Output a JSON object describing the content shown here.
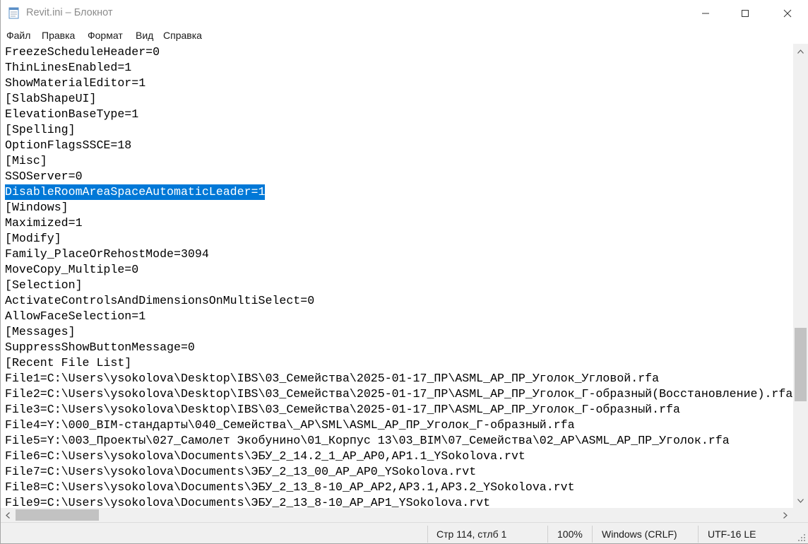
{
  "window": {
    "title": "Revit.ini – Блокнот"
  },
  "menu": {
    "items": [
      "Файл",
      "Правка",
      "Формат",
      "Вид",
      "Справка"
    ]
  },
  "editor": {
    "lines": [
      "FreezeScheduleHeader=0",
      "ThinLinesEnabled=1",
      "ShowMaterialEditor=1",
      "[SlabShapeUI]",
      "ElevationBaseType=1",
      "[Spelling]",
      "OptionFlagsSSCE=18",
      "[Misc]",
      "SSOServer=0",
      "DisableRoomAreaSpaceAutomaticLeader=1",
      "[Windows]",
      "Maximized=1",
      "[Modify]",
      "Family_PlaceOrRehostMode=3094",
      "MoveCopy_Multiple=0",
      "[Selection]",
      "ActivateControlsAndDimensionsOnMultiSelect=0",
      "AllowFaceSelection=1",
      "[Messages]",
      "SuppressShowButtonMessage=0",
      "[Recent File List]",
      "File1=C:\\Users\\ysokolova\\Desktop\\IBS\\03_Семейства\\2025-01-17_ПР\\ASML_АР_ПР_Уголок_Угловой.rfa",
      "File2=C:\\Users\\ysokolova\\Desktop\\IBS\\03_Семейства\\2025-01-17_ПР\\ASML_АР_ПР_Уголок_Г-образный(Восстановление).rfa",
      "File3=C:\\Users\\ysokolova\\Desktop\\IBS\\03_Семейства\\2025-01-17_ПР\\ASML_АР_ПР_Уголок_Г-образный.rfa",
      "File4=Y:\\000_BIM-стандарты\\040_Семейства\\_АР\\SML\\ASML_АР_ПР_Уголок_Г-образный.rfa",
      "File5=Y:\\003_Проекты\\027_Самолет Экобунино\\01_Корпус 13\\03_BIM\\07_Семейства\\02_АР\\ASML_АР_ПР_Уголок.rfa",
      "File6=C:\\Users\\ysokolova\\Documents\\ЭБУ_2_14.2_1_АР_АР0,АР1.1_YSokolova.rvt",
      "File7=C:\\Users\\ysokolova\\Documents\\ЭБУ_2_13_00_АР_АР0_YSokolova.rvt",
      "File8=C:\\Users\\ysokolova\\Documents\\ЭБУ_2_13_8-10_АР_АР2,АР3.1,АР3.2_YSokolova.rvt",
      "File9=C:\\Users\\ysokolova\\Documents\\ЭБУ_2_13_8-10_АР_АР1_YSokolova.rvt"
    ],
    "selected_line_index": 9
  },
  "statusbar": {
    "position": "Стр 114, стлб 1",
    "zoom": "100%",
    "line_ending": "Windows (CRLF)",
    "encoding": "UTF-16 LE"
  },
  "colors": {
    "selection": "#0078d7",
    "title_text": "#8c8c8c",
    "scrollbar_track": "#f0f0f0",
    "scrollbar_thumb": "#c2c2c2"
  }
}
